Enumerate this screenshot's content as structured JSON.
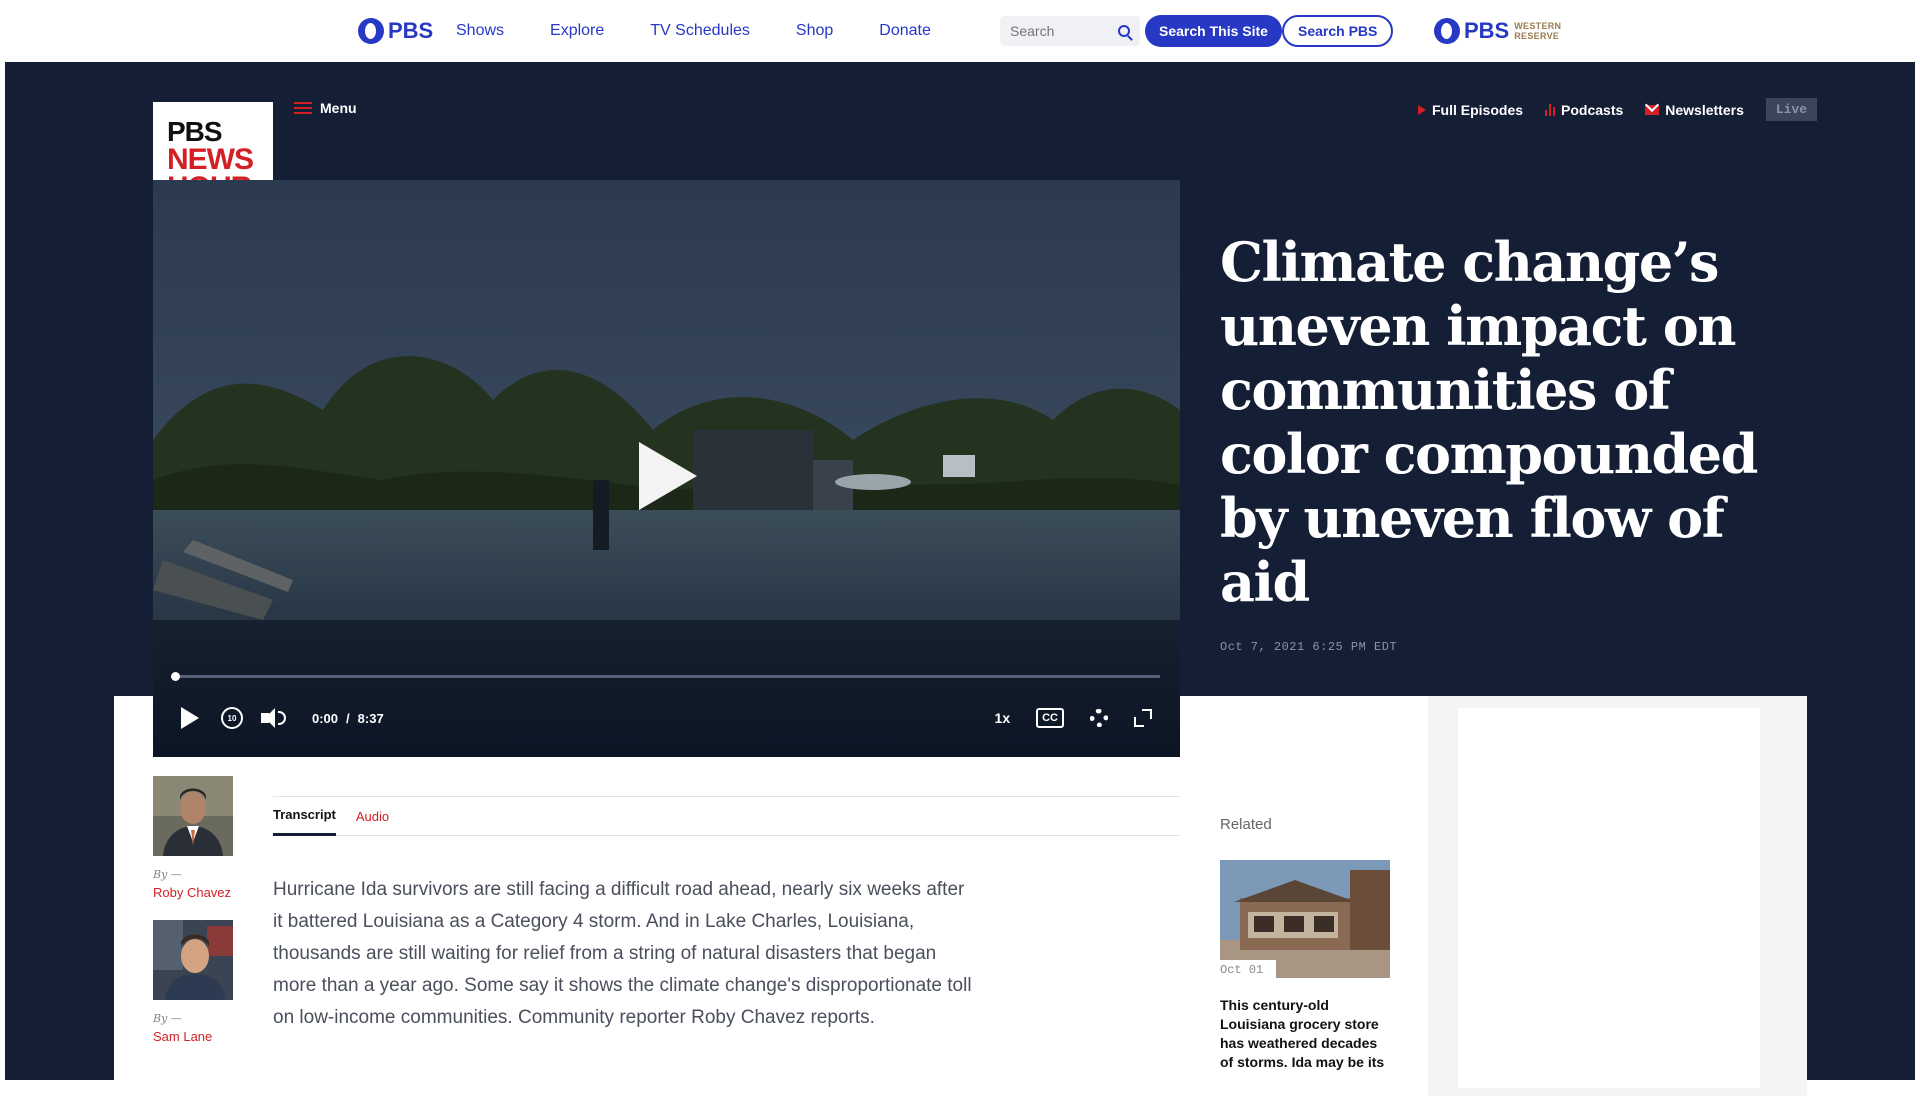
{
  "topbar": {
    "logo_text": "PBS",
    "nav": [
      "Shows",
      "Explore",
      "TV Schedules",
      "Shop",
      "Donate"
    ],
    "search_placeholder": "Search",
    "search_site_label": "Search This Site",
    "search_pbs_label": "Search PBS",
    "station_logo_text": "PBS",
    "station_name": "WESTERN RESERVE"
  },
  "header": {
    "brand_line1": "PBS",
    "brand_line2": "NEWS",
    "brand_line3": "HOUR",
    "menu_label": "Menu",
    "full_episodes": "Full Episodes",
    "podcasts": "Podcasts",
    "newsletters": "Newsletters",
    "live": "Live"
  },
  "video": {
    "current_time": "0:00",
    "separator": "/",
    "duration": "8:37",
    "progress_fraction": 0.0,
    "speed": "1x",
    "cc": "CC",
    "replay_seconds": "10"
  },
  "article": {
    "headline": "Climate change’s uneven impact on communities of color compounded by uneven flow of aid",
    "dateline": "Oct 7, 2021 6:25 PM EDT",
    "authors": [
      {
        "by": "By —",
        "name": "Roby Chavez"
      },
      {
        "by": "By —",
        "name": "Sam Lane"
      }
    ],
    "tabs": [
      "Transcript",
      "Audio"
    ],
    "summary": "Hurricane Ida survivors are still facing a difficult road ahead, nearly six weeks after it battered Louisiana as a Category 4 storm. And in Lake Charles, Louisiana, thousands are still waiting for relief from a string of natural disasters that began more than a year ago. Some say it shows the climate change's disproportionate toll on low-income communities. Community reporter Roby Chavez reports."
  },
  "related": {
    "label": "Related",
    "date": "Oct 01",
    "title": "This century-old Louisiana grocery store has weathered decades of storms. Ida may be its"
  },
  "colors": {
    "pbs_blue": "#2638c4",
    "hero_navy": "#141e35",
    "newshour_red": "#d32027"
  }
}
